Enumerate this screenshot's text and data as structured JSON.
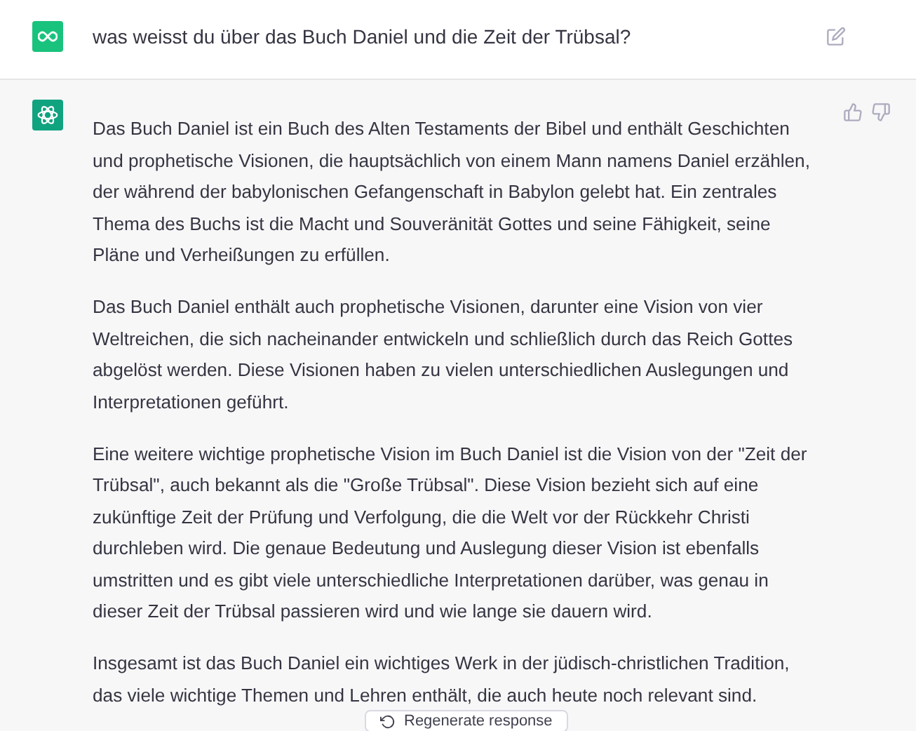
{
  "user_message": {
    "text": "was weisst du über das Buch Daniel und die Zeit der Trübsal?"
  },
  "assistant_message": {
    "paragraphs": [
      "Das Buch Daniel ist ein Buch des Alten Testaments der Bibel und enthält Geschichten und prophetische Visionen, die hauptsächlich von einem Mann namens Daniel erzählen, der während der babylonischen Gefangenschaft in Babylon gelebt hat. Ein zentrales Thema des Buchs ist die Macht und Souveränität Gottes und seine Fähigkeit, seine Pläne und Verheißungen zu erfüllen.",
      "Das Buch Daniel enthält auch prophetische Visionen, darunter eine Vision von vier Weltreichen, die sich nacheinander entwickeln und schließlich durch das Reich Gottes abgelöst werden. Diese Visionen haben zu vielen unterschiedlichen Auslegungen und Interpretationen geführt.",
      "Eine weitere wichtige prophetische Vision im Buch Daniel ist die Vision von der \"Zeit der Trübsal\", auch bekannt als die \"Große Trübsal\". Diese Vision bezieht sich auf eine zukünftige Zeit der Prüfung und Verfolgung, die die Welt vor der Rückkehr Christi durchleben wird. Die genaue Bedeutung und Auslegung dieser Vision ist ebenfalls umstritten und es gibt viele unterschiedliche Interpretationen darüber, was genau in dieser Zeit der Trübsal passieren wird und wie lange sie dauern wird.",
      "Insgesamt ist das Buch Daniel ein wichtiges Werk in der jüdisch-christlichen Tradition, das viele wichtige Themen und Lehren enthält, die auch heute noch relevant sind."
    ]
  },
  "regenerate_button": {
    "label": "Regenerate response"
  }
}
